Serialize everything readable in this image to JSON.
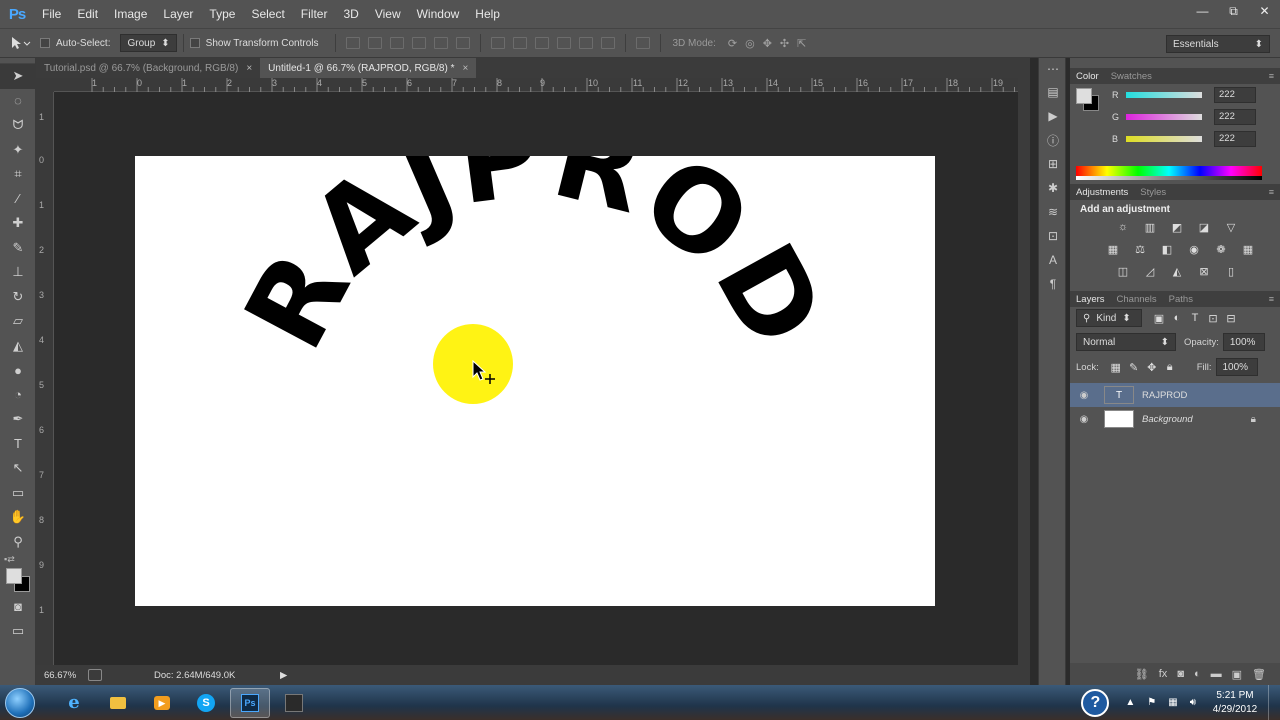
{
  "app": {
    "logo": "Ps"
  },
  "menu": [
    "File",
    "Edit",
    "Image",
    "Layer",
    "Type",
    "Select",
    "Filter",
    "3D",
    "View",
    "Window",
    "Help"
  ],
  "window_controls": {
    "minimize": "—",
    "maximize": "⧉",
    "close": "✕"
  },
  "options_bar": {
    "auto_select_label": "Auto-Select:",
    "auto_select_value": "Group",
    "show_transform_label": "Show Transform Controls",
    "mode_3d_label": "3D Mode:",
    "workspace": "Essentials"
  },
  "tabs": [
    {
      "label": "Tutorial.psd @ 66.7% (Background, RGB/8)",
      "close": "×"
    },
    {
      "label": "Untitled-1 @ 66.7% (RAJPROD, RGB/8) *",
      "close": "×"
    }
  ],
  "ruler": {
    "top": [
      "1",
      "0",
      "1",
      "2",
      "3",
      "4",
      "5",
      "6",
      "7",
      "8",
      "9",
      "10",
      "11",
      "12",
      "13",
      "14",
      "15",
      "16",
      "17",
      "18",
      "19"
    ],
    "left": [
      "1",
      "0",
      "1",
      "2",
      "3",
      "4",
      "5",
      "6",
      "7",
      "8",
      "9",
      "1"
    ]
  },
  "canvas": {
    "arc_text": "RAJPROD"
  },
  "status": {
    "zoom": "66.67%",
    "doc": "Doc: 2.64M/649.0K",
    "arrow": "▶"
  },
  "color_panel": {
    "tabs": [
      "Color",
      "Swatches"
    ],
    "channels": [
      {
        "label": "R",
        "value": "222"
      },
      {
        "label": "G",
        "value": "222"
      },
      {
        "label": "B",
        "value": "222"
      }
    ],
    "menu": "≡"
  },
  "adjustments_panel": {
    "tabs": [
      "Adjustments",
      "Styles"
    ],
    "heading": "Add an adjustment"
  },
  "layers_panel": {
    "tabs": [
      "Layers",
      "Channels",
      "Paths"
    ],
    "kind_label": "Kind",
    "blend_mode": "Normal",
    "opacity_label": "Opacity:",
    "opacity_value": "100%",
    "lock_label": "Lock:",
    "fill_label": "Fill:",
    "fill_value": "100%",
    "layers": [
      {
        "name": "RAJPROD",
        "thumb": "T"
      },
      {
        "name": "Background",
        "thumb": ""
      }
    ]
  },
  "taskbar": {
    "time": "5:21 PM",
    "date": "4/29/2012"
  },
  "colors": {
    "accent": "#4aa8ff",
    "canvas": "#ffffff",
    "highlight": "#fff200",
    "selected_layer": "#5a6e8c"
  }
}
